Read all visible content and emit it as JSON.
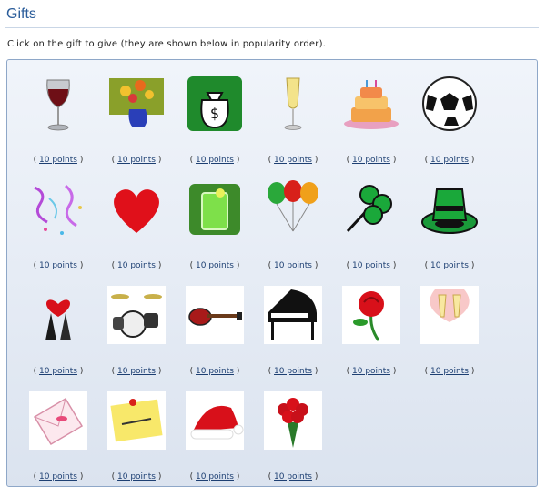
{
  "header": {
    "title": "Gifts"
  },
  "intro": "Click on the gift to give (they are shown below in popularity order).",
  "price": {
    "open": "(",
    "close": ")"
  },
  "gifts": [
    {
      "icon": "wine-glass-icon",
      "points": "10 points"
    },
    {
      "icon": "flower-vase-icon",
      "points": "10 points"
    },
    {
      "icon": "money-bag-icon",
      "points": "10 points"
    },
    {
      "icon": "champagne-glass-icon",
      "points": "10 points"
    },
    {
      "icon": "birthday-cake-icon",
      "points": "10 points"
    },
    {
      "icon": "soccer-ball-icon",
      "points": "10 points"
    },
    {
      "icon": "streamers-icon",
      "points": "10 points"
    },
    {
      "icon": "heart-icon",
      "points": "10 points"
    },
    {
      "icon": "green-drink-icon",
      "points": "10 points"
    },
    {
      "icon": "balloons-icon",
      "points": "10 points"
    },
    {
      "icon": "shamrock-icon",
      "points": "10 points"
    },
    {
      "icon": "leprechaun-hat-icon",
      "points": "10 points"
    },
    {
      "icon": "valentine-couple-icon",
      "points": "10 points"
    },
    {
      "icon": "drum-kit-icon",
      "points": "10 points"
    },
    {
      "icon": "electric-guitar-icon",
      "points": "10 points"
    },
    {
      "icon": "grand-piano-icon",
      "points": "10 points"
    },
    {
      "icon": "red-rose-icon",
      "points": "10 points"
    },
    {
      "icon": "champagne-toast-icon",
      "points": "10 points"
    },
    {
      "icon": "love-letter-icon",
      "points": "10 points"
    },
    {
      "icon": "love-you-note-icon",
      "points": "10 points"
    },
    {
      "icon": "santa-hat-icon",
      "points": "10 points"
    },
    {
      "icon": "rose-bouquet-icon",
      "points": "10 points"
    }
  ]
}
